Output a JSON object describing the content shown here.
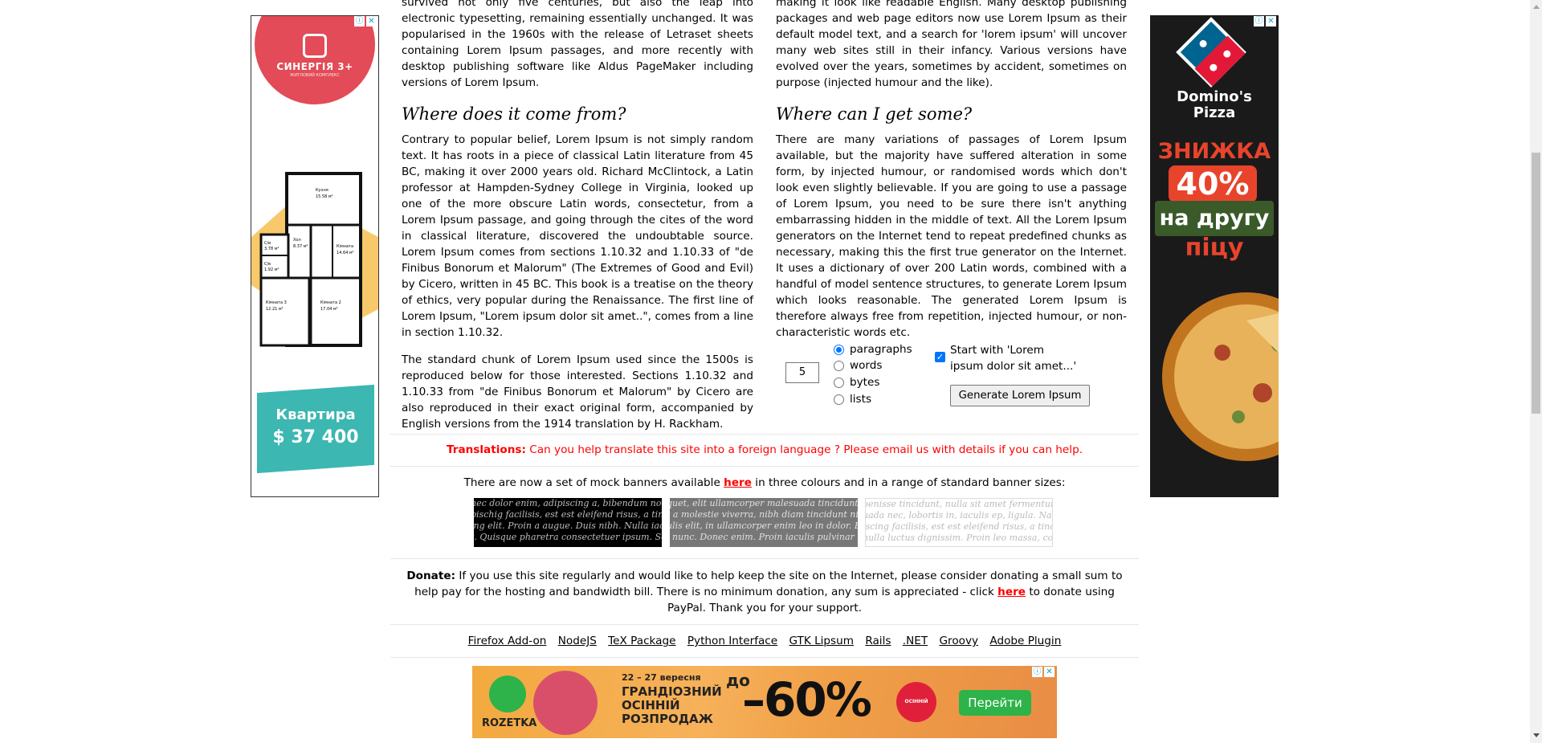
{
  "left_ad": {
    "brand": "СИНЕРГІЯ 3+",
    "brand_sub": "ЖИТЛОВИЙ КОМПЛЕКС",
    "price_label": "Квартира",
    "price_value": "$ 37 400",
    "rooms": [
      {
        "name": "Кухня",
        "area": "15.58 м²"
      },
      {
        "name": "Хол",
        "area": "8.37 м²"
      },
      {
        "name": "С/в",
        "area": "3.78 м²"
      },
      {
        "name": "С/в",
        "area": "1.92 м²"
      },
      {
        "name": "Кімната",
        "area": "14.64 м²"
      },
      {
        "name": "Кімната 3",
        "area": "12.21 м²"
      },
      {
        "name": "Кімната 2",
        "area": "17.04 м²"
      }
    ]
  },
  "right_ad": {
    "brand_line1": "Domino's",
    "brand_line2": "Pizza",
    "promo1": "ЗНИЖКА",
    "promo2": "40%",
    "promo3": "на другу",
    "promo4": "піцу"
  },
  "adchoices_icon": "info-icon",
  "close_icon": "close-icon",
  "left_column": {
    "intro": "survived not only five centuries, but also the leap into electronic typesetting, remaining essentially unchanged. It was popularised in the 1960s with the release of Letraset sheets containing Lorem Ipsum passages, and more recently with desktop publishing software like Aldus PageMaker including versions of Lorem Ipsum.",
    "heading": "Where does it come from?",
    "para1": "Contrary to popular belief, Lorem Ipsum is not simply random text. It has roots in a piece of classical Latin literature from 45 BC, making it over 2000 years old. Richard McClintock, a Latin professor at Hampden-Sydney College in Virginia, looked up one of the more obscure Latin words, consectetur, from a Lorem Ipsum passage, and going through the cites of the word in classical literature, discovered the undoubtable source. Lorem Ipsum comes from sections 1.10.32 and 1.10.33 of \"de Finibus Bonorum et Malorum\" (The Extremes of Good and Evil) by Cicero, written in 45 BC. This book is a treatise on the theory of ethics, very popular during the Renaissance. The first line of Lorem Ipsum, \"Lorem ipsum dolor sit amet..\", comes from a line in section 1.10.32.",
    "para2": "The standard chunk of Lorem Ipsum used since the 1500s is reproduced below for those interested. Sections 1.10.32 and 1.10.33 from \"de Finibus Bonorum et Malorum\" by Cicero are also reproduced in their exact original form, accompanied by English versions from the 1914 translation by H. Rackham."
  },
  "right_column": {
    "intro": "making it look like readable English. Many desktop publishing packages and web page editors now use Lorem Ipsum as their default model text, and a search for 'lorem ipsum' will uncover many web sites still in their infancy. Various versions have evolved over the years, sometimes by accident, sometimes on purpose (injected humour and the like).",
    "heading": "Where can I get some?",
    "para1": "There are many variations of passages of Lorem Ipsum available, but the majority have suffered alteration in some form, by injected humour, or randomised words which don't look even slightly believable. If you are going to use a passage of Lorem Ipsum, you need to be sure there isn't anything embarrassing hidden in the middle of text. All the Lorem Ipsum generators on the Internet tend to repeat predefined chunks as necessary, making this the first true generator on the Internet. It uses a dictionary of over 200 Latin words, combined with a handful of model sentence structures, to generate Lorem Ipsum which looks reasonable. The generated Lorem Ipsum is therefore always free from repetition, injected humour, or non-characteristic words etc."
  },
  "generator": {
    "amount": "5",
    "options": [
      {
        "label": "paragraphs",
        "checked": true
      },
      {
        "label": "words",
        "checked": false
      },
      {
        "label": "bytes",
        "checked": false
      },
      {
        "label": "lists",
        "checked": false
      }
    ],
    "start_with_label": "Start with 'Lorem ipsum dolor sit amet...'",
    "start_with_checked": true,
    "button_label": "Generate Lorem Ipsum"
  },
  "translations": {
    "label": "Translations:",
    "text": "Can you help translate this site into a foreign language ? Please email us with details if you can help."
  },
  "banners": {
    "text_before": "There are now a set of mock banners available",
    "link": "here",
    "text_after": "in three colours and in a range of standard banner sizes:",
    "samples": [
      [
        "nec dolor enim, adipiscing a, bibendum non, ca",
        "pischig facilisis, est est eleifend risus, a tincidu",
        "ing elit. Proin a augue. Duis nibh. Nulla iacul",
        "t. Quisque pharetra consectetuer ipsum. Sed"
      ],
      [
        "quet, elit ullamcorper malesuada tincidunt,",
        "t a molestie viverra, nibh diam tincidunt ni",
        "ulis elit, in ullamcorper enim leo in dolor. Et",
        ". nunc. Donec enim. Proin iaculis pulvinar ni"
      ],
      [
        "benisse tincidunt, nulla sit amet fermentum",
        "uada nec, lobortis in, iaculis ep, ligula. Nam",
        "iscing facilisis, est est eleifend risus, a tincid",
        "nulla luctus dignissim. Proin leo massa, comm"
      ]
    ]
  },
  "donate": {
    "label": "Donate:",
    "text_before": "If you use this site regularly and would like to help keep the site on the Internet, please consider donating a small sum to help pay for the hosting and bandwidth bill. There is no minimum donation, any sum is appreciated - click",
    "link": "here",
    "text_after": "to donate using PayPal. Thank you for your support."
  },
  "footer_links": [
    "Firefox Add-on",
    "NodeJS",
    "TeX Package",
    "Python Interface",
    "GTK Lipsum",
    "Rails",
    ".NET",
    "Groovy",
    "Adobe Plugin"
  ],
  "bottom_ad": {
    "brand": "ROZETKA",
    "dates": "22 – 27 вересня",
    "sale_line1": "ГРАНДІОЗНИЙ",
    "sale_line2": "ОСІННІЙ",
    "sale_line3": "РОЗПРОДАЖ",
    "upto": "до",
    "percent": "–60%",
    "badge": "ОСІННІЙ РОЗПРОДАЖ",
    "button": "Перейти"
  }
}
